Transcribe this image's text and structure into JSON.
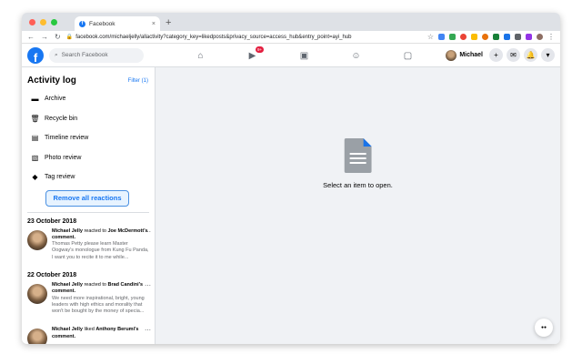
{
  "browser": {
    "tab_title": "Facebook",
    "tab_close": "×",
    "new_tab": "+",
    "url": "facebook.com/michaeljelly/allactivity?category_key=likedposts&privacy_source=access_hub&entry_point=ayi_hub",
    "nav": {
      "back": "←",
      "forward": "→",
      "reload": "↻"
    },
    "star": "☆",
    "menu": "⋮"
  },
  "fb": {
    "logo": "f",
    "search_placeholder": "Search Facebook",
    "watch_badge": "9+",
    "profile_name": "Michael",
    "icons": [
      "home-icon",
      "watch-icon",
      "marketplace-icon",
      "groups-icon",
      "gaming-icon"
    ],
    "create": "+",
    "messenger": "✉",
    "notifications": "🔔",
    "account": "▾"
  },
  "sidebar": {
    "title": "Activity log",
    "filter": "Filter (1)",
    "items": [
      {
        "label": "Archive",
        "icon": "archive-icon"
      },
      {
        "label": "Recycle bin",
        "icon": "trash-icon"
      },
      {
        "label": "Timeline review",
        "icon": "timeline-review-icon"
      },
      {
        "label": "Photo review",
        "icon": "photo-review-icon"
      },
      {
        "label": "Tag review",
        "icon": "tag-icon"
      }
    ],
    "remove_button": "Remove all reactions",
    "groups": [
      {
        "date": "23 October 2018",
        "actor": "Michael Jelly",
        "action": " reacted to ",
        "target": "Joe McDermott's comment.",
        "snippet": "Thomas Petty please learn Master Oogway's monologue from Kung Fu Panda, I want you to recite it to me while..."
      },
      {
        "date": "22 October 2018",
        "actor": "Michael Jelly",
        "action": " reacted to ",
        "target": "Brad Candini's comment.",
        "snippet": "We need more inspirational, bright, young leaders with high ethics and morality that won't be bought by the money of specia..."
      },
      {
        "date": "",
        "actor": "Michael Jelly",
        "action": " liked ",
        "target": "Anthony Berumi's comment.",
        "snippet": ""
      }
    ]
  },
  "content": {
    "empty_text": "Select an item to open.",
    "help_icon": "help-icon"
  },
  "colors": {
    "brand": "#1877f2",
    "badge": "#e41e3f",
    "doc": "#9aa0a6",
    "doc_corner": "#1a73e8"
  }
}
